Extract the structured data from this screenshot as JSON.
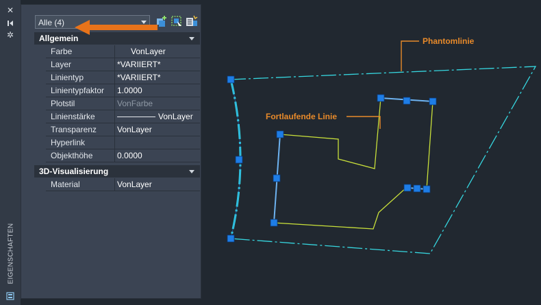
{
  "palette": {
    "title_bar": "#323a46",
    "panel": "#3b4453",
    "section": "#2b323c",
    "canvas": "#212830",
    "accent_arrow": "#e8731a",
    "phantom_line": "#36d7e0",
    "continuous_line": "#c9e03a",
    "grip": "#1e7de6",
    "annotation": "#e88a2a"
  },
  "titlebar": {
    "icons": [
      "close-icon",
      "pin-icon",
      "settings-icon",
      "properties-icon"
    ],
    "title": "EIGENSCHAFTEN"
  },
  "selector": {
    "value": "Alle (4)"
  },
  "toolbar": {
    "icons": [
      "toggle-pickadd-icon",
      "select-objects-icon",
      "quick-select-icon"
    ]
  },
  "sections": [
    {
      "title": "Allgemein",
      "rows": [
        {
          "key": "Farbe",
          "value": "VonLayer"
        },
        {
          "key": "Layer",
          "value": "*VARIIERT*"
        },
        {
          "key": "Linientyp",
          "value": "*VARIIERT*"
        },
        {
          "key": "Linientypfaktor",
          "value": "1.0000"
        },
        {
          "key": "Plotstil",
          "value": "VonFarbe"
        },
        {
          "key": "Linienstärke",
          "value": "VonLayer"
        },
        {
          "key": "Transparenz",
          "value": "VonLayer"
        },
        {
          "key": "Hyperlink",
          "value": ""
        },
        {
          "key": "Objekthöhe",
          "value": "0.0000"
        }
      ]
    },
    {
      "title": "3D-Visualisierung",
      "rows": [
        {
          "key": "Material",
          "value": "VonLayer"
        }
      ]
    }
  ],
  "annotations": {
    "phantom": "Phantomlinie",
    "continuous": "Fortlaufende Linie"
  }
}
